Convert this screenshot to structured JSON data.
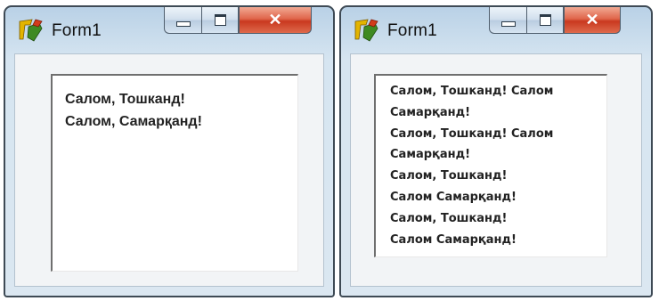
{
  "windows": [
    {
      "title": "Form1",
      "caption_buttons": {
        "minimize": "minimize",
        "maximize": "maximize",
        "close": "close"
      },
      "memo_lines": [
        "Салом, Тошканд!",
        "Салом, Самарқанд!"
      ]
    },
    {
      "title": "Form1",
      "caption_buttons": {
        "minimize": "minimize",
        "maximize": "maximize",
        "close": "close"
      },
      "memo_lines": [
        "Салом, Тошканд! Салом",
        "Самарқанд!",
        "Салом, Тошканд! Салом",
        "Самарқанд!",
        "Салом, Тошканд!",
        "Салом Самарқанд!",
        "Салом, Тошканд!",
        "Салом Самарқанд!"
      ]
    }
  ],
  "icons": {
    "app": "delphi-app-icon",
    "minimize": "minimize-icon",
    "maximize": "maximize-icon",
    "close": "close-icon"
  },
  "colors": {
    "close_button": "#d24a2f",
    "title_bar": "#b9d1e6",
    "memo_bg": "#ffffff"
  }
}
